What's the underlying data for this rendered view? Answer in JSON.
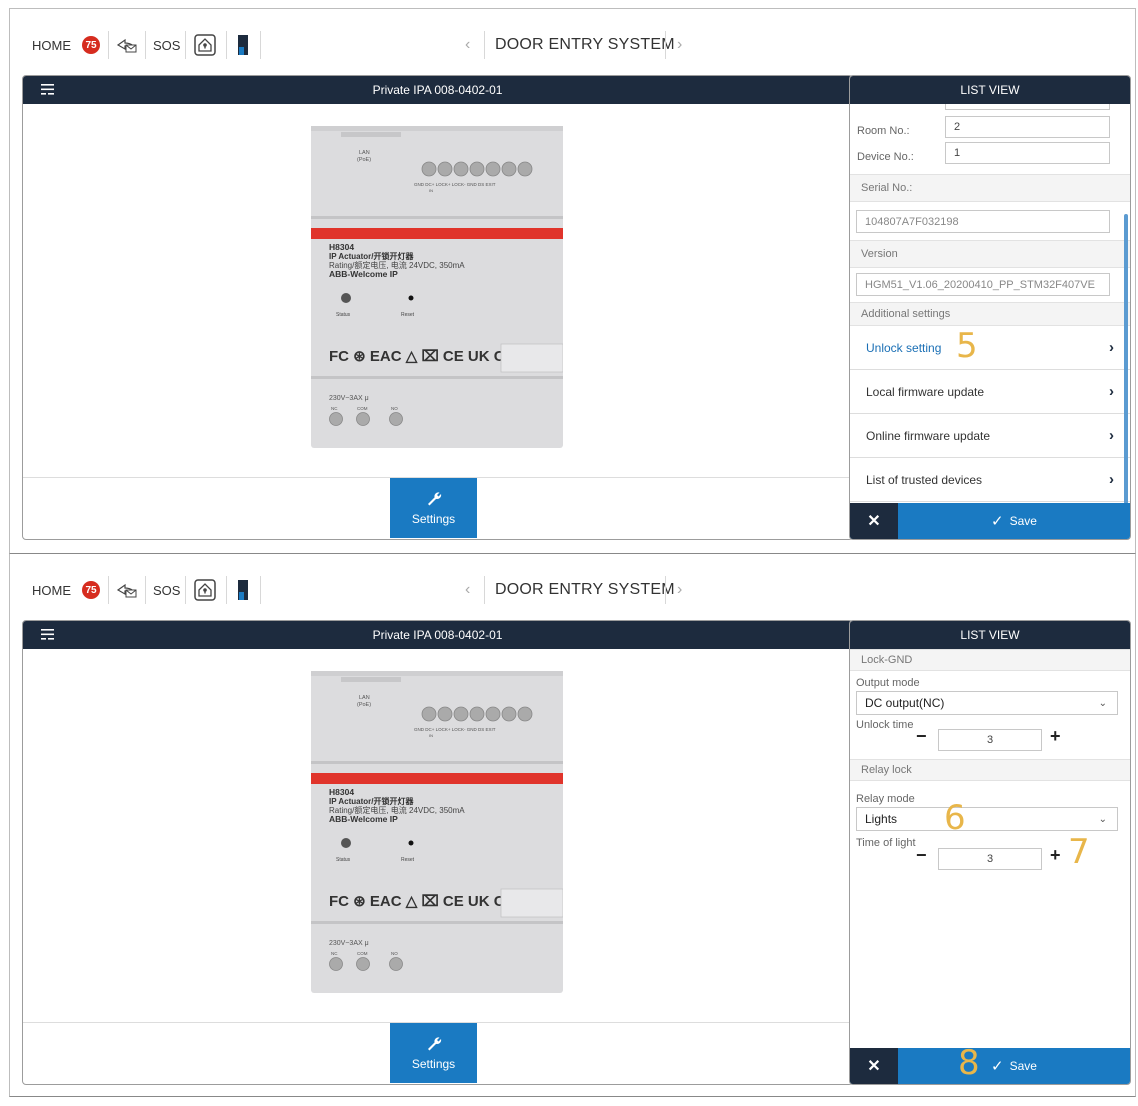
{
  "topbar": {
    "home_label": "HOME",
    "badge_count": "75",
    "sos_label": "SOS",
    "title": "DOOR ENTRY SYSTEM",
    "prev_chevron": "‹",
    "next_chevron": "›"
  },
  "main": {
    "header_title": "Private IPA 008-0402-01",
    "settings_label": "Settings"
  },
  "device_label": {
    "lan": "LAN",
    "poe": "(PoE)",
    "terminals": "GND DC+ LOCK+ LOCK- GND DS EXIT",
    "in_mark": "IN",
    "model": "H8304",
    "name": "IP Actuator/开锁开灯器",
    "rating": "Rating/额定电压, 电流 24VDC, 350mA",
    "brand": "ABB-Welcome IP",
    "status": "Status",
    "reset": "Reset",
    "certs": "FC ⊛ EAC △ ⌧ CE UK CA",
    "relay_rating": "230V~3AX μ",
    "relay_nc": "NC",
    "relay_com": "COM",
    "relay_no": "NO"
  },
  "panel1": {
    "header": "LIST VIEW",
    "room_label": "Room No.:",
    "room_value": "2",
    "device_label": "Device No.:",
    "device_value": "1",
    "serial_label": "Serial No.:",
    "serial_value": "104807A7F032198",
    "version_label": "Version",
    "version_value": "HGM51_V1.06_20200410_PP_STM32F407VE",
    "additional_label": "Additional settings",
    "items": [
      {
        "label": "Unlock setting"
      },
      {
        "label": "Local firmware update"
      },
      {
        "label": "Online firmware update"
      },
      {
        "label": "List of trusted devices"
      }
    ],
    "cancel": "✕",
    "save": "Save",
    "annotation": "5"
  },
  "panel2": {
    "header": "LIST VIEW",
    "lock_gnd_label": "Lock-GND",
    "output_mode_label": "Output mode",
    "output_mode_value": "DC output(NC)",
    "unlock_time_label": "Unlock time",
    "unlock_time_value": "3",
    "relay_lock_label": "Relay lock",
    "relay_mode_label": "Relay mode",
    "relay_mode_value": "Lights",
    "time_of_light_label": "Time of light",
    "time_of_light_value": "3",
    "minus": "−",
    "plus": "+",
    "cancel": "✕",
    "save": "Save",
    "annotation_6": "6",
    "annotation_7": "7",
    "annotation_8": "8"
  },
  "colors": {
    "navy": "#1d2b3e",
    "blue": "#1a7ac2",
    "badge_red": "#d62c1f",
    "annotation_gold": "#e8b64a",
    "device_stripe": "#e0342b"
  }
}
